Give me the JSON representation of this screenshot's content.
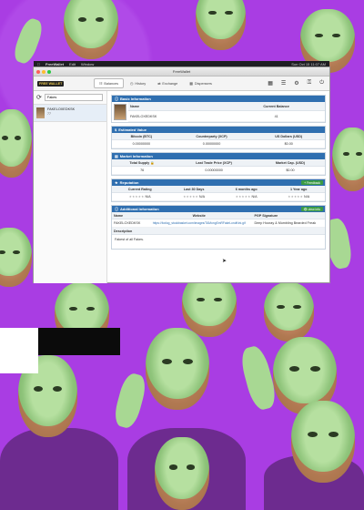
{
  "menubar": {
    "app": "FreeWallet",
    "menu1": "Edit",
    "menu2": "Window",
    "clock": "Sun Oct 15 11:07 AM"
  },
  "window": {
    "title": "FreeWallet"
  },
  "toolbar": {
    "logo": "FREE WALLET",
    "tabs": [
      {
        "label": "Balances",
        "icon": "balances-icon"
      },
      {
        "label": "History",
        "icon": "history-icon"
      },
      {
        "label": "Exchange",
        "icon": "exchange-icon"
      },
      {
        "label": "Dispensers",
        "icon": "dispensers-icon"
      }
    ],
    "tools": [
      "grid-icon",
      "list-icon",
      "gear-icon",
      "lock-icon",
      "power-icon"
    ]
  },
  "sidebar": {
    "search_value": "Fakes",
    "asset": {
      "name": "FAKELOXEDKSK",
      "count": "77"
    }
  },
  "basic": {
    "header": "Basic Information",
    "col_name": "Name",
    "col_balance": "Current Balance",
    "name": "FAKELOXEDKSK",
    "balance": "41"
  },
  "estimated": {
    "header": "Estimated Value",
    "cols": [
      "Bitcoin (BTC)",
      "Counterparty (XCP)",
      "US Dollars (USD)"
    ],
    "vals": [
      "0.00000000",
      "0.00000000",
      "$0.00"
    ]
  },
  "market": {
    "header": "Market Information",
    "cols": [
      "Total Supply",
      "Last Trade Price (XCP)",
      "Market Cap. (USD)"
    ],
    "vals": [
      "76",
      "0.00000000",
      "$0.00"
    ]
  },
  "reputation": {
    "header": "Reputation",
    "button": "Feedback",
    "cols": [
      "Current Rating",
      "Last 30 Days",
      "6 months ago",
      "1 Year ago"
    ],
    "vals": [
      "N/A",
      "N/A",
      "N/A",
      "N/A"
    ]
  },
  "additional": {
    "header": "Additional Information",
    "button": "view info",
    "cols": [
      "Name",
      "Website",
      "PGP Signature"
    ],
    "name": "FAKELOXEDKSK",
    "website": "https://foxlog_stockbasket.com/images/TAMongSmRFakeLondKek.gif",
    "pgp": "Deep Hooray & Mumbling Bearded Freak"
  },
  "description": {
    "header": "Description",
    "text": "Fakest of all Fakes."
  },
  "colors": {
    "accent": "#2f6fb0",
    "success": "#3c9b44",
    "wallpaper": "#a93de3"
  }
}
